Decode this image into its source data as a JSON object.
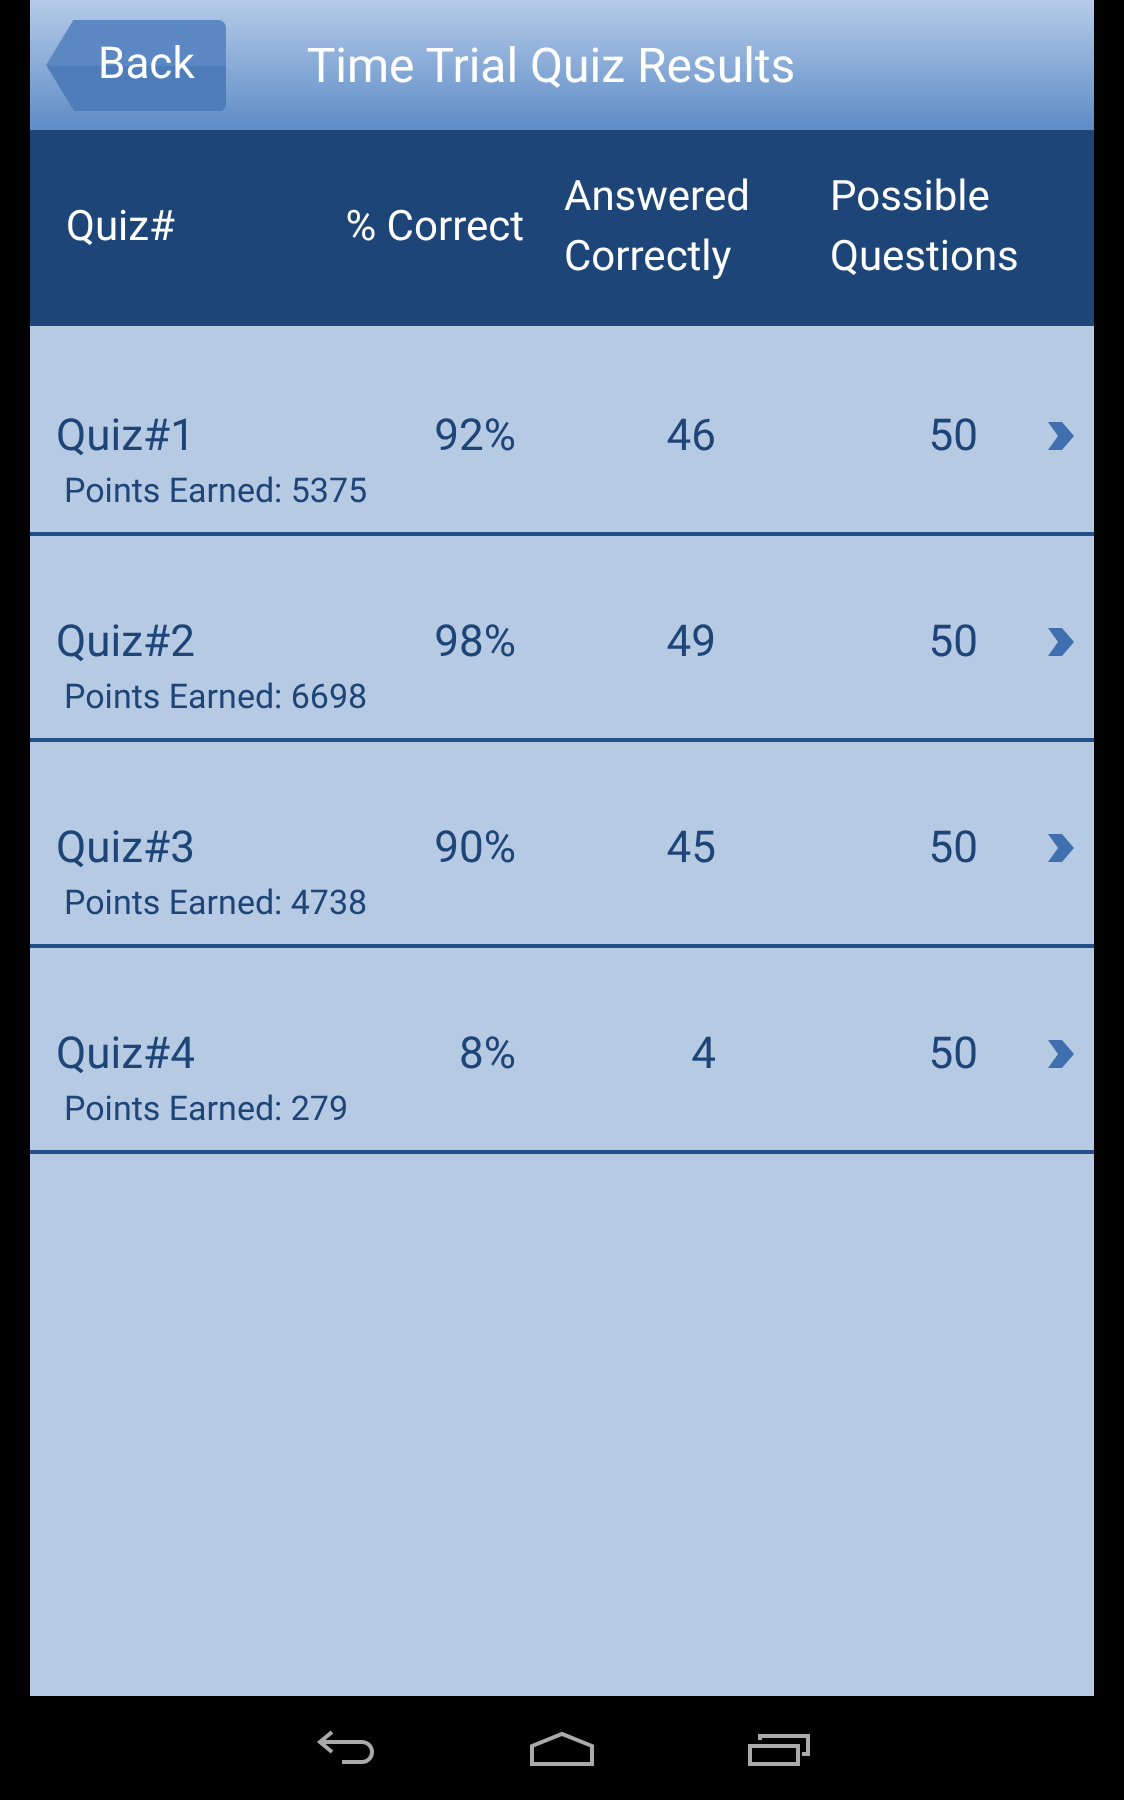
{
  "header": {
    "back_label": "Back",
    "title": "Time Trial Quiz Results"
  },
  "table": {
    "columns": [
      "Quiz#",
      "% Correct",
      "Answered Correctly",
      "Possible Questions"
    ],
    "rows": [
      {
        "quiz": "Quiz#1",
        "percent": "92%",
        "answered": "46",
        "possible": "50",
        "points": "Points Earned: 5375"
      },
      {
        "quiz": "Quiz#2",
        "percent": "98%",
        "answered": "49",
        "possible": "50",
        "points": "Points Earned: 6698"
      },
      {
        "quiz": "Quiz#3",
        "percent": "90%",
        "answered": "45",
        "possible": "50",
        "points": "Points Earned: 4738"
      },
      {
        "quiz": "Quiz#4",
        "percent": "8%",
        "answered": "4",
        "possible": "50",
        "points": "Points Earned: 279"
      }
    ]
  }
}
